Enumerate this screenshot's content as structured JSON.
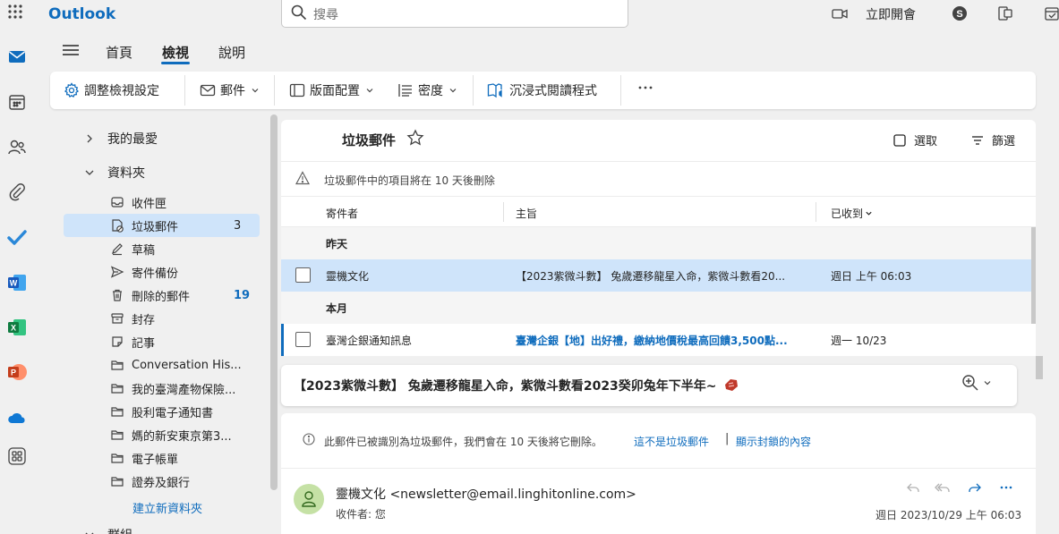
{
  "app": {
    "brand": "Outlook"
  },
  "search": {
    "placeholder": "搜尋"
  },
  "topbar": {
    "meet_now": "立即開會"
  },
  "ribbon": {
    "tabs": [
      "首頁",
      "檢視",
      "說明"
    ],
    "toolbar": {
      "view_settings": "調整檢視設定",
      "messages": "郵件",
      "layout": "版面配置",
      "density": "密度",
      "immersive_reader": "沉浸式閱讀程式"
    }
  },
  "folders": {
    "favorites": "我的最愛",
    "folders_header": "資料夾",
    "items": [
      {
        "label": "收件匣",
        "icon": "inbox-icon",
        "count": ""
      },
      {
        "label": "垃圾郵件",
        "icon": "junk-icon",
        "count": "3"
      },
      {
        "label": "草稿",
        "icon": "draft-icon",
        "count": ""
      },
      {
        "label": "寄件備份",
        "icon": "sent-icon",
        "count": ""
      },
      {
        "label": "刪除的郵件",
        "icon": "trash-icon",
        "count": "19"
      },
      {
        "label": "封存",
        "icon": "archive-icon",
        "count": ""
      },
      {
        "label": "記事",
        "icon": "notes-icon",
        "count": ""
      },
      {
        "label": "Conversation His...",
        "icon": "folder-icon",
        "count": ""
      },
      {
        "label": "我的臺灣產物保險...",
        "icon": "folder-icon",
        "count": ""
      },
      {
        "label": "股利電子通知書",
        "icon": "folder-icon",
        "count": ""
      },
      {
        "label": "媽的新安東京第3...",
        "icon": "folder-icon",
        "count": ""
      },
      {
        "label": "電子帳單",
        "icon": "folder-icon",
        "count": ""
      },
      {
        "label": "證券及銀行",
        "icon": "folder-icon",
        "count": ""
      }
    ],
    "new_folder": "建立新資料夾",
    "groups_header": "群組"
  },
  "mail_list": {
    "title": "垃圾郵件",
    "select": "選取",
    "filter": "篩選",
    "notice": "垃圾郵件中的項目將在 10 天後刪除",
    "columns": {
      "sender": "寄件者",
      "subject": "主旨",
      "received": "已收到"
    },
    "groups": [
      {
        "label": "昨天",
        "messages": [
          {
            "sender": "靈機文化",
            "subject": "【2023紫微斗數】 兔歲遷移龍星入命，紫微斗數看20...",
            "date": "週日 上午 06:03"
          }
        ]
      },
      {
        "label": "本月",
        "messages": [
          {
            "sender": "臺灣企銀通知訊息",
            "subject": "臺灣企銀【地】出好禮，繳納地價稅最高回饋3,500點...",
            "date": "週一 10/23"
          }
        ]
      }
    ]
  },
  "reading_pane": {
    "subject": "【2023紫微斗數】 兔歲遷移龍星入命，紫微斗數看2023癸卯兔年下半年~",
    "junk_banner": "此郵件已被識別為垃圾郵件，我們會在 10 天後將它刪除。",
    "not_junk": "這不是垃圾郵件",
    "separator": "|",
    "show_blocked": "顯示封鎖的內容",
    "from": "靈機文化 <newsletter@email.linghitonline.com>",
    "to": "收件者: 您",
    "date": "週日 2023/10/29 上午 06:03"
  },
  "colors": {
    "accent": "#0f6cbd",
    "selected": "#cfe4fa",
    "background": "#f0f0f0"
  }
}
